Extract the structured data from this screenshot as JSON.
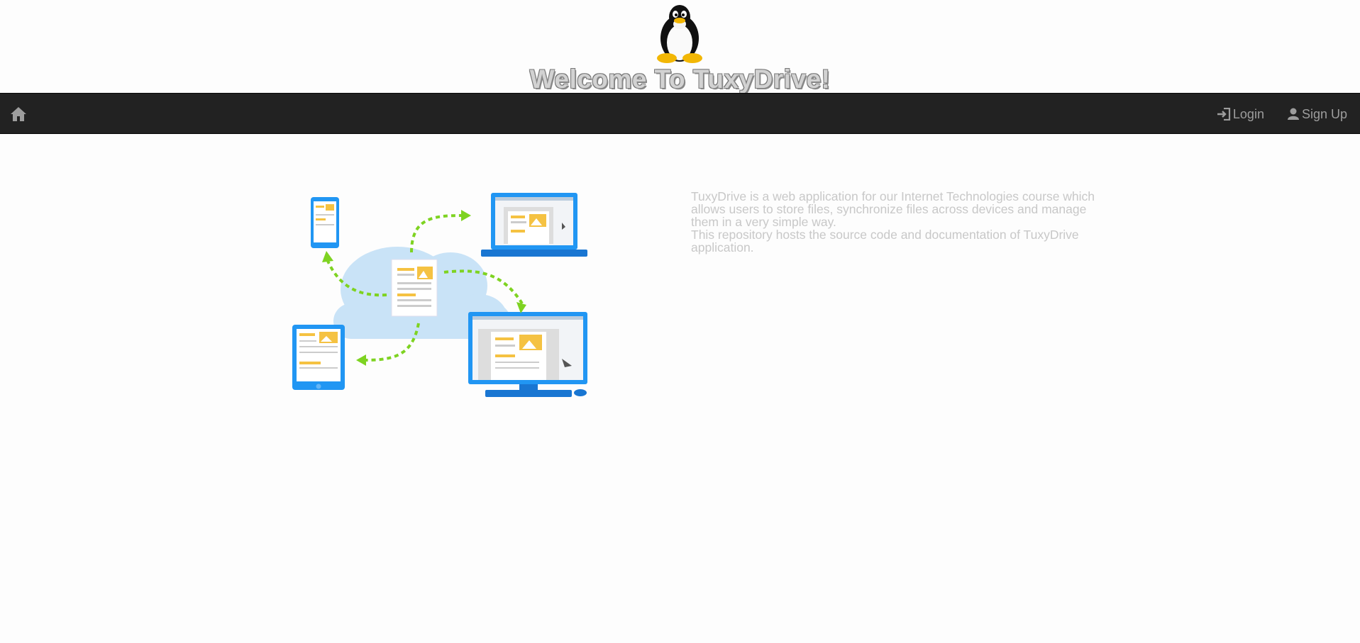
{
  "header": {
    "title": "Welcome To TuxyDrive!",
    "logo_icon": "tux-penguin-icon"
  },
  "navbar": {
    "home_icon": "home-icon",
    "links": [
      {
        "label": "Login",
        "icon": "login-icon"
      },
      {
        "label": "Sign Up",
        "icon": "user-icon"
      }
    ]
  },
  "main": {
    "illustration": "cloud-sync-devices-illustration",
    "description": [
      "TuxyDrive is a web application for our Internet Technologies course which allows users to store files, synchronize files across devices and manage them in a very simple way.",
      "This repository hosts the source code and documentation of TuxyDrive application."
    ]
  },
  "colors": {
    "navbar_bg": "#222222",
    "nav_text": "#9d9d9d",
    "description_text": "#c8c8c8",
    "device_blue": "#2196f3",
    "arrow_green": "#7ed321",
    "accent_yellow": "#f5c242"
  }
}
